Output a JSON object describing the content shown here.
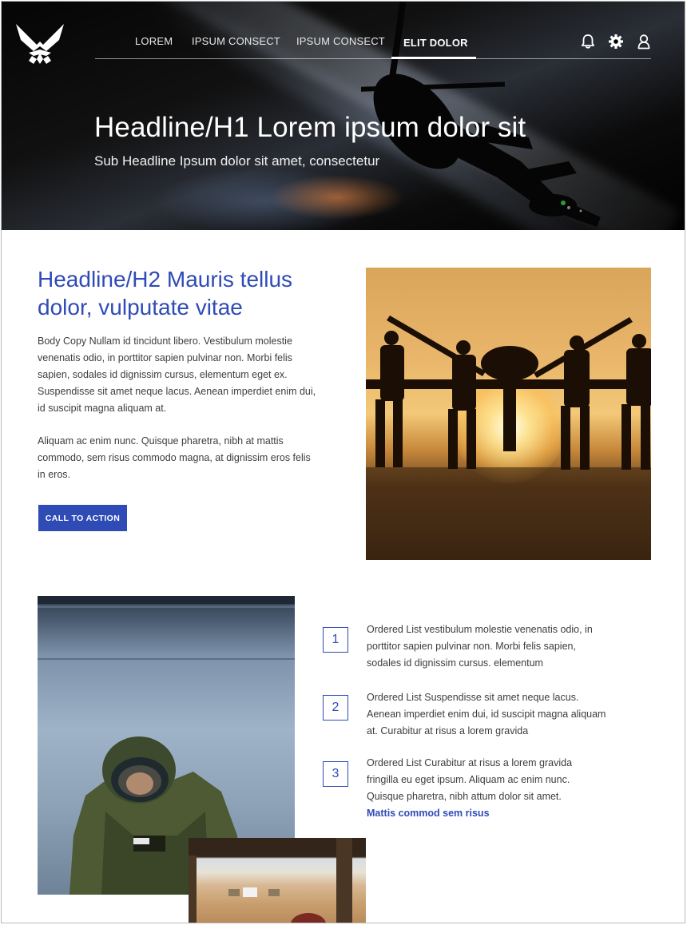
{
  "nav": {
    "items": [
      {
        "label": "LOREM"
      },
      {
        "label": "IPSUM CONSECT"
      },
      {
        "label": "IPSUM CONSECT"
      },
      {
        "label": "ELIT DOLOR"
      }
    ],
    "active_index": 3,
    "icons": [
      "bell-icon",
      "gear-icon",
      "user-icon"
    ]
  },
  "hero": {
    "title": "Headline/H1 Lorem ipsum dolor sit",
    "subtitle": "Sub Headline Ipsum dolor sit amet, consectetur"
  },
  "section1": {
    "headline_line1": "Headline/H2 Mauris tellus",
    "headline_line2": "dolor, vulputate vitae",
    "body_1": "Body Copy Nullam id tincidunt libero. Vestibulum molestie venenatis odio, in porttitor sapien pulvinar non. Morbi felis sapien, sodales id dignissim cursus, elementum eget ex. Suspendisse sit amet neque lacus. Aenean imperdiet enim dui, id suscipit magna aliquam at.",
    "body_2": "Aliquam ac enim nunc. Quisque pharetra, nibh at mattis commodo, sem risus commodo magna, at dignissim eros felis in eros.",
    "cta_label": "CALL TO ACTION"
  },
  "ordered_list": [
    {
      "number": "1",
      "text": "Ordered List vestibulum molestie venenatis odio, in porttitor sapien pulvinar non. Morbi felis sapien, sodales id dignissim cursus. elementum"
    },
    {
      "number": "2",
      "text": "Ordered List Suspendisse sit amet neque lacus. Aenean imperdiet enim dui, id suscipit magna aliquam at. Curabitur at risus a lorem gravida"
    },
    {
      "number": "3",
      "text": "Ordered List Curabitur at risus a lorem gravida fringilla eu eget ipsum. Aliquam ac enim nunc. Quisque pharetra, nibh attum dolor sit amet.",
      "link": "Mattis commod sem risus"
    }
  ],
  "colors": {
    "accent": "#2f4bb6",
    "body_text": "#3d3d3d",
    "hero_text": "#ffffff"
  }
}
